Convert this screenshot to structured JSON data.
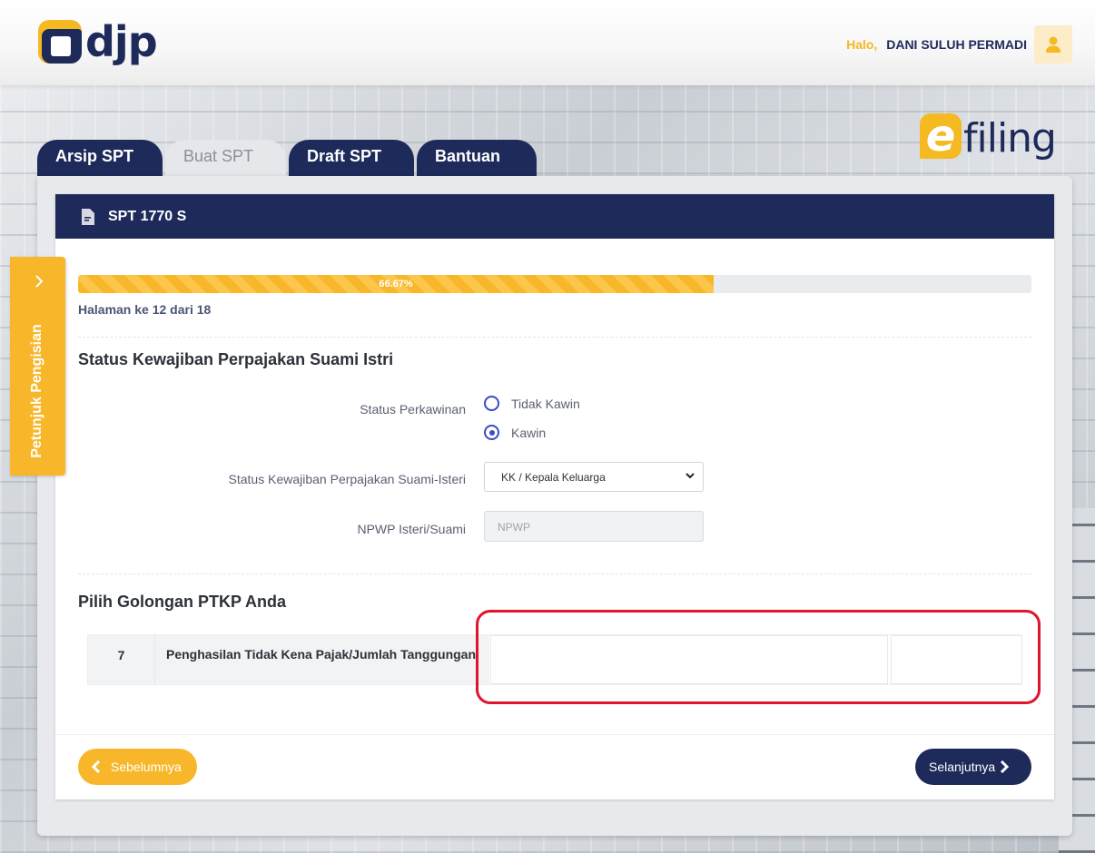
{
  "header": {
    "logo_text": "djp",
    "greeting": "Halo,",
    "user_name": "DANI SULUH PERMADI",
    "avatar_icon": "user-icon"
  },
  "brand": {
    "efiling_e": "e",
    "efiling_text": "filing",
    "accent": "#f5b921",
    "navy": "#1e2a5a"
  },
  "tabs": [
    {
      "label": "Arsip SPT",
      "active": false
    },
    {
      "label": "Buat SPT",
      "active": true
    },
    {
      "label": "Draft SPT",
      "active": false
    },
    {
      "label": "Bantuan",
      "active": false
    }
  ],
  "card": {
    "title": "SPT 1770 S",
    "title_icon": "document-icon"
  },
  "progress": {
    "percent_label": "66.67%",
    "value": 0.6667,
    "page_info": "Halaman ke 12 dari 18"
  },
  "section1": {
    "title": "Status Kewajiban Perpajakan Suami Istri",
    "marital_label": "Status Perkawinan",
    "marital_options": [
      {
        "label": "Tidak Kawin",
        "checked": false
      },
      {
        "label": "Kawin",
        "checked": true
      }
    ],
    "obligation_label": "Status Kewajiban Perpajakan Suami-Isteri",
    "obligation_value": "KK / Kepala Keluarga",
    "npwp_label": "NPWP Isteri/Suami",
    "npwp_placeholder": "NPWP"
  },
  "section2": {
    "title": "Pilih Golongan PTKP Anda",
    "row_number": "7",
    "row_label": "Penghasilan Tidak Kena Pajak/Jumlah Tanggungan"
  },
  "footer": {
    "prev_label": "Sebelumnya",
    "next_label": "Selanjutnya"
  },
  "side_guide": {
    "label": "Petunjuk Pengisian"
  }
}
